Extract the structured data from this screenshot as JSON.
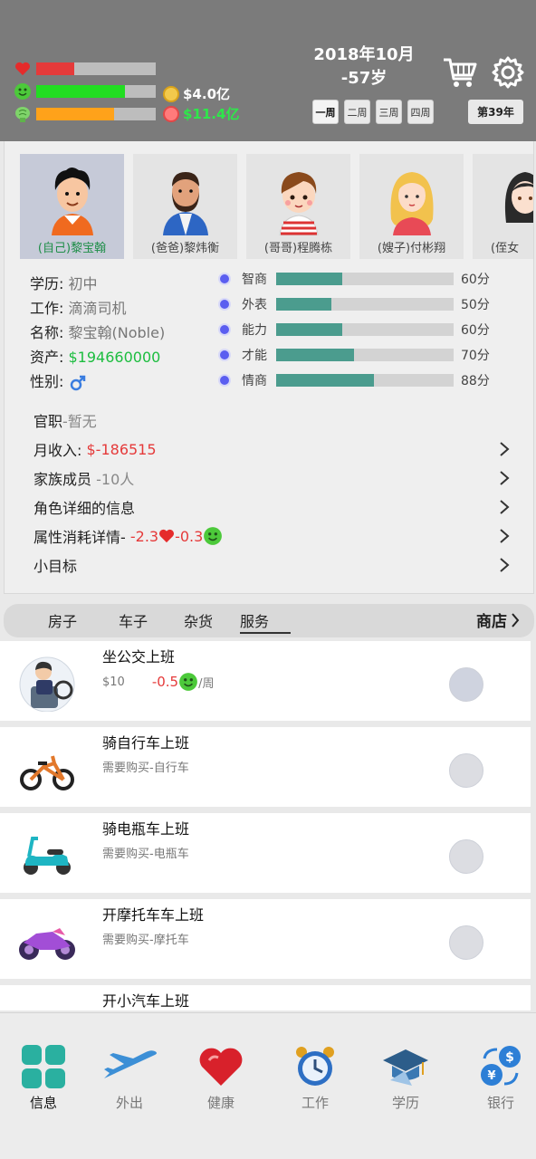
{
  "header": {
    "date": "2018年10月",
    "age": "-57岁",
    "money": "$4.0亿",
    "debt": "$11.4亿",
    "weeks": [
      "一周",
      "二周",
      "三周",
      "四周"
    ],
    "active_week": 0,
    "year_label": "第39年",
    "health": 0.32,
    "mood": 0.74,
    "energy": 0.65,
    "colors": {
      "health": "#e53a3a",
      "mood": "#22dd22",
      "energy": "#ffa21a"
    }
  },
  "characters": [
    {
      "name": "(自己)黎宝翰",
      "selected": true
    },
    {
      "name": "(爸爸)黎炜衡",
      "selected": false
    },
    {
      "name": "(哥哥)程腾栋",
      "selected": false
    },
    {
      "name": "(嫂子)付彬翔",
      "selected": false
    },
    {
      "name": "(侄女",
      "selected": false
    }
  ],
  "profile": {
    "education_label": "学历:",
    "education": "初中",
    "job_label": "工作:",
    "job": "滴滴司机",
    "name_label": "名称:",
    "name": "黎宝翰(Noble)",
    "assets_label": "资产:",
    "assets": "$194660000",
    "gender_label": "性别:"
  },
  "attributes": [
    {
      "label": "智商",
      "value": "60分",
      "level": 0.37
    },
    {
      "label": "外表",
      "value": "50分",
      "level": 0.31
    },
    {
      "label": "能力",
      "value": "60分",
      "level": 0.37
    },
    {
      "label": "才能",
      "value": "70分",
      "level": 0.44
    },
    {
      "label": "情商",
      "value": "88分",
      "level": 0.55
    }
  ],
  "menu": {
    "position_label": "官职",
    "position_value": "-暂无",
    "income_label": "月收入:",
    "income_value": "$-186515",
    "family_label": "家族成员",
    "family_value": "-10人",
    "details_label": "角色详细的信息",
    "consume_label": "属性消耗详情-",
    "consume_health": "-2.3",
    "consume_mood": "-0.3",
    "goal_label": "小目标"
  },
  "tabs": {
    "items": [
      "房子",
      "车子",
      "杂货",
      "服务"
    ],
    "active": 3,
    "shop": "商店"
  },
  "services": [
    {
      "title": "坐公交上班",
      "price": "$10",
      "delta": "-0.5",
      "unit": "/周",
      "selected": true
    },
    {
      "title": "骑自行车上班",
      "note": "需要购买-自行车"
    },
    {
      "title": "骑电瓶车上班",
      "note": "需要购买-电瓶车"
    },
    {
      "title": "开摩托车车上班",
      "note": "需要购买-摩托车"
    },
    {
      "title": "开小汽车上班"
    }
  ],
  "nav": [
    "信息",
    "外出",
    "健康",
    "工作",
    "学历",
    "银行"
  ],
  "nav_active": 0
}
